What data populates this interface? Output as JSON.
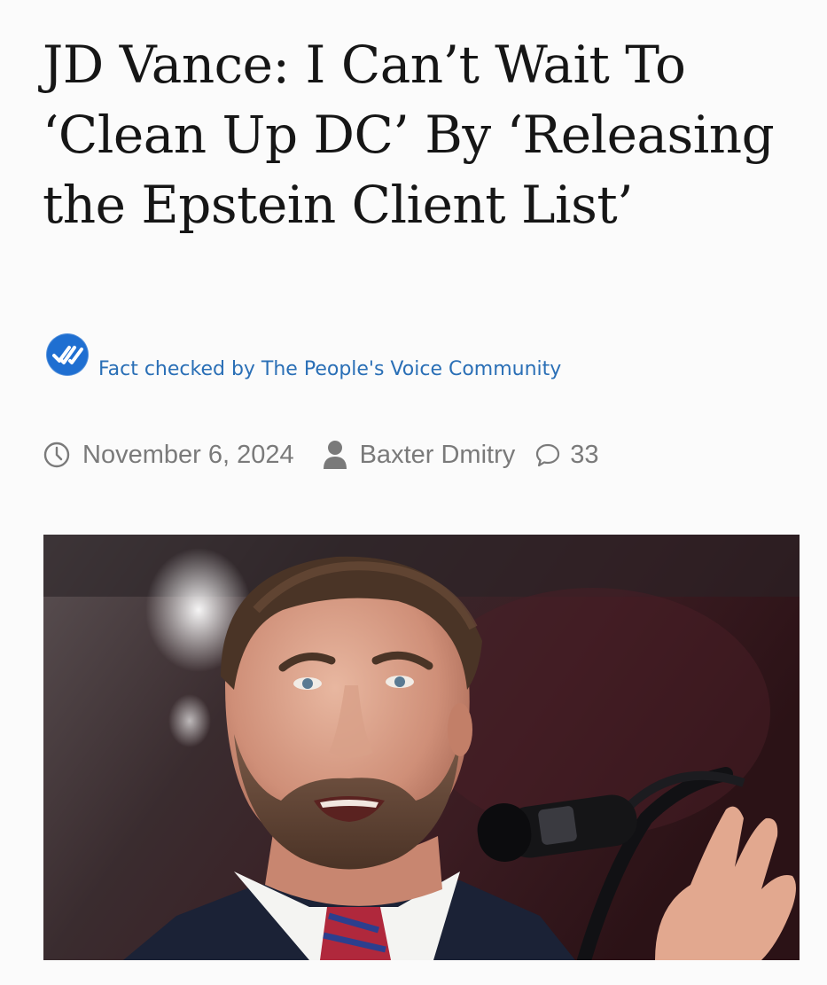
{
  "article": {
    "headline": "JD Vance: I Can’t Wait To ‘Clean Up DC’ By ‘Releasing the Epstein Client List’",
    "fact_check_label": "Fact checked by The People's Voice Community",
    "date": "November 6, 2024",
    "author": "Baxter Dmitry",
    "comment_count": "33"
  },
  "icons": {
    "fact_check": "double-check-badge-icon",
    "date": "clock-icon",
    "author": "person-icon",
    "comments": "speech-bubble-icon"
  },
  "colors": {
    "background": "#fbfbfb",
    "headline": "#161616",
    "badge": "#1f6fd1",
    "fact_text": "#2a6fb6",
    "meta_text": "#7a7a7a"
  },
  "image": {
    "subject": "man with beard speaking at microphone"
  }
}
